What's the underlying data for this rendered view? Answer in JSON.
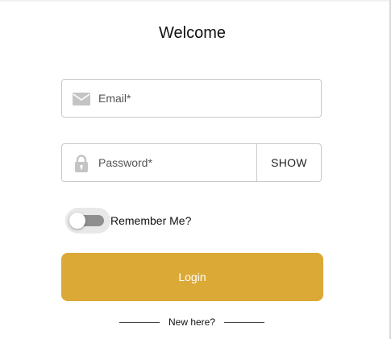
{
  "form": {
    "title": "Welcome",
    "email": {
      "placeholder": "Email*",
      "value": "",
      "icon": "envelope-icon"
    },
    "password": {
      "placeholder": "Password*",
      "value": "",
      "icon": "lock-icon",
      "show_label": "SHOW"
    },
    "remember": {
      "label": "Remember Me?",
      "checked": false
    },
    "login_label": "Login",
    "new_here": "New here?"
  },
  "colors": {
    "accent": "#dba935",
    "icon": "#c4c4c4",
    "border": "#c9c9c9"
  }
}
